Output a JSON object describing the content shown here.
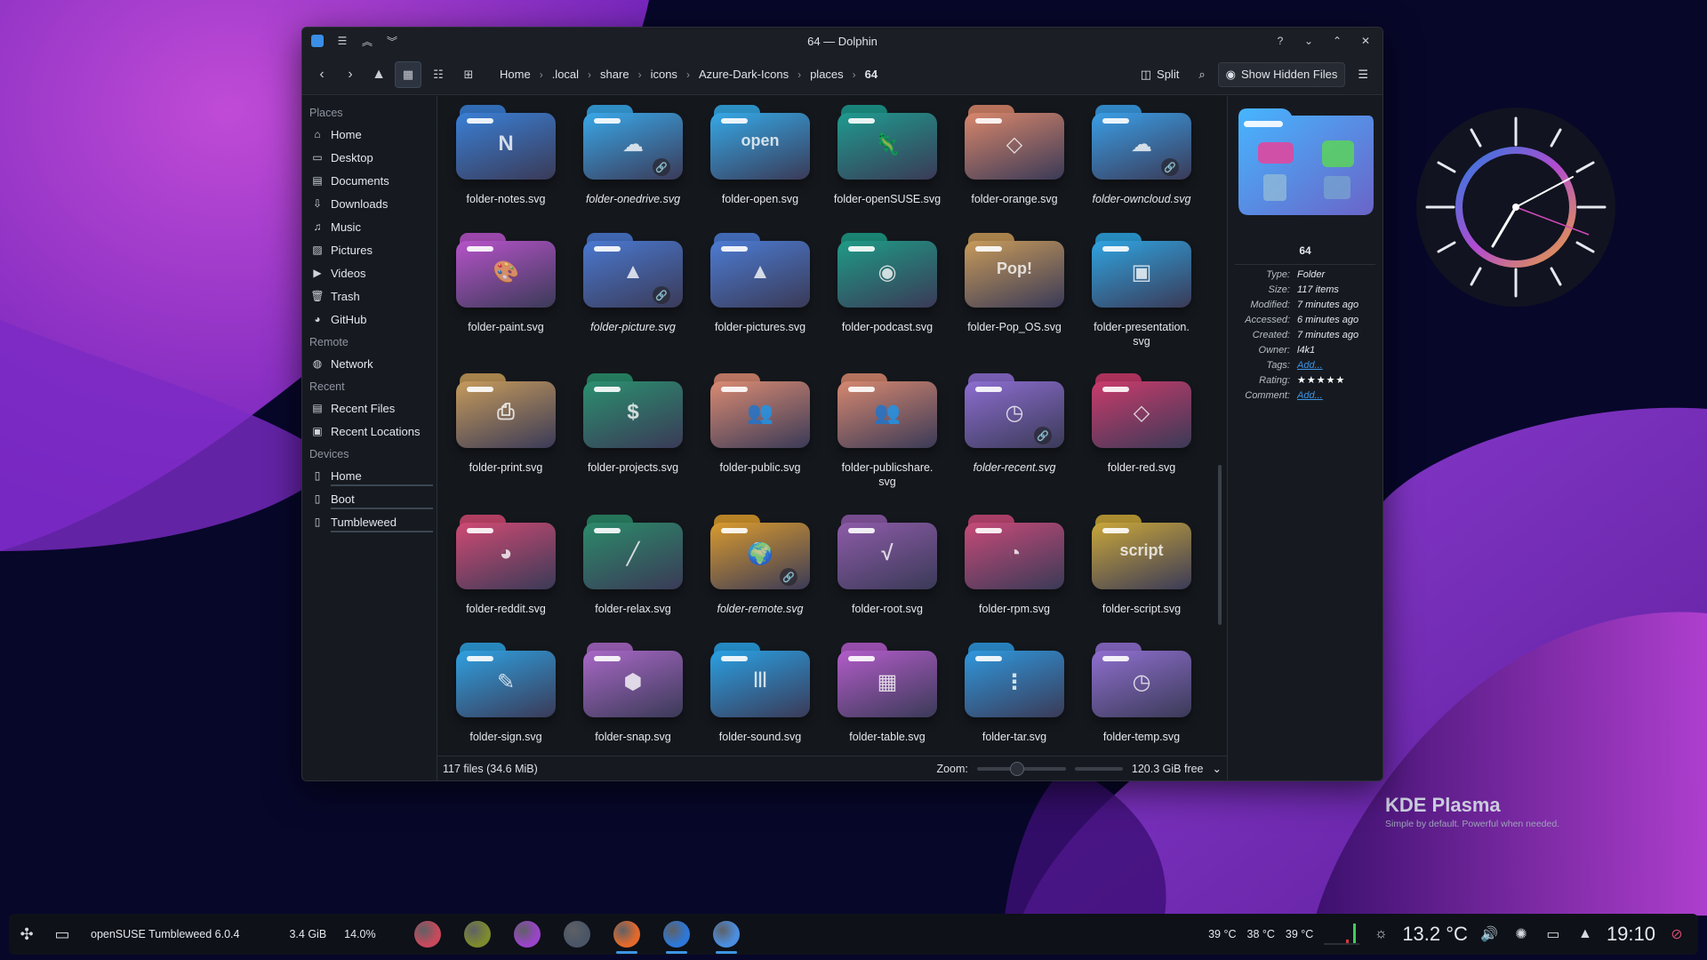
{
  "colors": {
    "accent": "#3d95e6",
    "window_bg": "#14171c",
    "panel_bg": "#161a20",
    "wallpaper_purple": "#8f2fc2",
    "wallpaper_bg": "#07072a"
  },
  "window": {
    "title": "64 — Dolphin",
    "titlebar_buttons": [
      "help-icon",
      "minimize-icon",
      "maximize-icon",
      "close-icon"
    ]
  },
  "toolbar": {
    "breadcrumbs": [
      "Home",
      ".local",
      "share",
      "icons",
      "Azure-Dark-Icons",
      "places",
      "64"
    ],
    "split_label": "Split",
    "show_hidden_label": "Show Hidden Files"
  },
  "sidebar": {
    "sections": [
      {
        "title": "Places",
        "items": [
          {
            "label": "Home",
            "icon": "home-icon"
          },
          {
            "label": "Desktop",
            "icon": "desktop-icon"
          },
          {
            "label": "Documents",
            "icon": "documents-icon"
          },
          {
            "label": "Downloads",
            "icon": "downloads-icon"
          },
          {
            "label": "Music",
            "icon": "music-icon"
          },
          {
            "label": "Pictures",
            "icon": "pictures-icon"
          },
          {
            "label": "Videos",
            "icon": "videos-icon"
          },
          {
            "label": "Trash",
            "icon": "trash-icon"
          },
          {
            "label": "GitHub",
            "icon": "github-icon"
          }
        ]
      },
      {
        "title": "Remote",
        "items": [
          {
            "label": "Network",
            "icon": "network-icon"
          }
        ]
      },
      {
        "title": "Recent",
        "items": [
          {
            "label": "Recent Files",
            "icon": "recent-files-icon"
          },
          {
            "label": "Recent Locations",
            "icon": "recent-locations-icon"
          }
        ]
      },
      {
        "title": "Devices",
        "items": [
          {
            "label": "Home",
            "icon": "drive-icon"
          },
          {
            "label": "Boot",
            "icon": "drive-icon"
          },
          {
            "label": "Tumbleweed",
            "icon": "drive-icon"
          }
        ]
      }
    ]
  },
  "files": [
    {
      "name": "folder-notes.svg",
      "color": "#3a7fd5",
      "glyph": "N",
      "link": false
    },
    {
      "name": "folder-onedrive.svg",
      "color": "#39a7e8",
      "glyph": "☁",
      "link": true
    },
    {
      "name": "folder-open.svg",
      "color": "#35a8e6",
      "glyph": "open",
      "link": false
    },
    {
      "name": "folder-openSUSE.svg",
      "color": "#1f9a8e",
      "glyph": "🦎",
      "link": false
    },
    {
      "name": "folder-orange.svg",
      "color": "#d8866b",
      "glyph": "◇",
      "link": false
    },
    {
      "name": "folder-owncloud.svg",
      "color": "#3a9ee6",
      "glyph": "☁",
      "link": true
    },
    {
      "name": "folder-paint.svg",
      "color": "#b653c9",
      "glyph": "🎨",
      "link": false
    },
    {
      "name": "folder-picture.svg",
      "color": "#4a78cf",
      "glyph": "▲",
      "link": true
    },
    {
      "name": "folder-pictures.svg",
      "color": "#4c7bd2",
      "glyph": "▲",
      "link": false
    },
    {
      "name": "folder-podcast.svg",
      "color": "#1f9a86",
      "glyph": "◉",
      "link": false
    },
    {
      "name": "folder-Pop_OS.svg",
      "color": "#c79a5a",
      "glyph": "Pop!",
      "link": false
    },
    {
      "name": "folder-presentation.\nsvg",
      "color": "#2fa3df",
      "glyph": "▣",
      "link": false
    },
    {
      "name": "folder-print.svg",
      "color": "#c59a5b",
      "glyph": "⎙",
      "link": false
    },
    {
      "name": "folder-projects.svg",
      "color": "#2b8f6f",
      "glyph": "$",
      "link": false
    },
    {
      "name": "folder-public.svg",
      "color": "#d98a72",
      "glyph": "👥",
      "link": false
    },
    {
      "name": "folder-publicshare.\nsvg",
      "color": "#d5876f",
      "glyph": "👥",
      "link": false
    },
    {
      "name": "folder-recent.svg",
      "color": "#8c6dd0",
      "glyph": "◷",
      "link": true
    },
    {
      "name": "folder-red.svg",
      "color": "#c93b6b",
      "glyph": "◇",
      "link": false
    },
    {
      "name": "folder-reddit.svg",
      "color": "#cf4a73",
      "glyph": "◕",
      "link": false
    },
    {
      "name": "folder-relax.svg",
      "color": "#2c8a6a",
      "glyph": "╱",
      "link": false
    },
    {
      "name": "folder-remote.svg",
      "color": "#d99a2e",
      "glyph": "🌍",
      "link": true
    },
    {
      "name": "folder-root.svg",
      "color": "#8d5ba8",
      "glyph": "√",
      "link": false
    },
    {
      "name": "folder-rpm.svg",
      "color": "#c64a78",
      "glyph": "◔",
      "link": false
    },
    {
      "name": "folder-script.svg",
      "color": "#c9a63a",
      "glyph": "script",
      "link": false
    },
    {
      "name": "folder-sign.svg",
      "color": "#2fa0e0",
      "glyph": "✎",
      "link": false
    },
    {
      "name": "folder-snap.svg",
      "color": "#a868c6",
      "glyph": "⬢",
      "link": false
    },
    {
      "name": "folder-sound.svg",
      "color": "#2aa0e3",
      "glyph": "|||",
      "link": false
    },
    {
      "name": "folder-table.svg",
      "color": "#b25cc9",
      "glyph": "▦",
      "link": false
    },
    {
      "name": "folder-tar.svg",
      "color": "#2f97dc",
      "glyph": "⋮",
      "link": false
    },
    {
      "name": "folder-temp.svg",
      "color": "#8f6fcf",
      "glyph": "◷",
      "link": false
    }
  ],
  "status": {
    "summary": "117 files (34.6 MiB)",
    "zoom_label": "Zoom:",
    "zoom_level": 0.45,
    "free_space": "120.3 GiB free"
  },
  "info": {
    "name": "64",
    "rows": [
      {
        "key": "Type:",
        "value": "Folder",
        "link": false
      },
      {
        "key": "Size:",
        "value": "117 items",
        "link": false
      },
      {
        "key": "Modified:",
        "value": "7 minutes ago",
        "link": false
      },
      {
        "key": "Accessed:",
        "value": "6 minutes ago",
        "link": false
      },
      {
        "key": "Created:",
        "value": "7 minutes ago",
        "link": false
      },
      {
        "key": "Owner:",
        "value": "l4k1",
        "link": false
      },
      {
        "key": "Tags:",
        "value": "Add...",
        "link": true
      },
      {
        "key": "Rating:",
        "value": "★★★★★",
        "link": false
      },
      {
        "key": "Comment:",
        "value": "Add...",
        "link": true
      }
    ]
  },
  "plasma": {
    "name": "KDE Plasma",
    "tagline": "Simple by default. Powerful when  needed."
  },
  "taskbar": {
    "distro": "openSUSE Tumbleweed 6.0.4",
    "memory": "3.4 GiB",
    "cpu": "14.0%",
    "apps": [
      {
        "icon": "app-settings-icon",
        "color": "#c8495c",
        "active": false
      },
      {
        "icon": "app-game-icon",
        "color": "#7d8a2e",
        "active": false
      },
      {
        "icon": "app-shop-icon",
        "color": "#9a44c9",
        "active": false
      },
      {
        "icon": "app-mixer-icon",
        "color": "#4a5566",
        "active": false
      },
      {
        "icon": "firefox-icon",
        "color": "#e2692c",
        "active": true
      },
      {
        "icon": "dolphin-icon",
        "color": "#2d78d8",
        "active": true
      },
      {
        "icon": "app-kde-icon",
        "color": "#4b8ee0",
        "active": true
      }
    ],
    "temps": [
      "39 °C",
      "38 °C",
      "39 °C"
    ],
    "weather": "13.2 °C",
    "time": "19:10"
  }
}
